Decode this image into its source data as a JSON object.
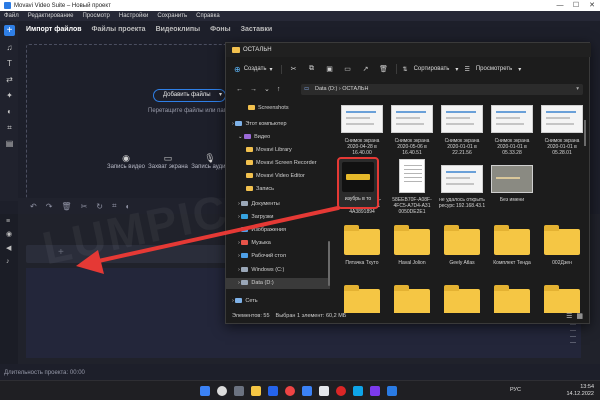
{
  "app": {
    "title": "Movavi Video Suite – Новый проект",
    "window_controls": [
      "—",
      "☐",
      "✕"
    ]
  },
  "menubar": [
    "Файл",
    "Редактирование",
    "Просмотр",
    "Настройки",
    "Сохранить",
    "Справка"
  ],
  "tabs": [
    {
      "label": "Импорт файлов",
      "active": true
    },
    {
      "label": "Файлы проекта"
    },
    {
      "label": "Видеоклипы"
    },
    {
      "label": "Фоны"
    },
    {
      "label": "Заставки"
    }
  ],
  "import": {
    "add_files_label": "Добавить файлы",
    "drop_hint": "Перетащите файлы или папки сюда",
    "buttons": [
      {
        "label": "Запись видео",
        "icon": "webcam-icon"
      },
      {
        "label": "Захват экрана",
        "icon": "monitor-icon"
      },
      {
        "label": "Запись аудио",
        "icon": "microphone-icon"
      }
    ]
  },
  "status": {
    "duration": "Длительность проекта: 00:00"
  },
  "watermark": "LUMPICS.RU",
  "explorer": {
    "title": "ОСТАЛЬН",
    "toolbar": {
      "new_label": "Создать",
      "sort_label": "Сортировать",
      "view_label": "Просмотреть"
    },
    "address": "Data (D:)  ›  ОСТАЛЬН",
    "nav": [
      {
        "label": "Screenshots",
        "color": "#f2c14e"
      },
      {
        "label": "Этот компьютер",
        "color": "#7fb2e8"
      },
      {
        "label": "Видео",
        "color": "#9b6ad8"
      },
      {
        "label": "Movavi Library",
        "color": "#f2c14e"
      },
      {
        "label": "Movavi Screen Recorder",
        "color": "#f2c14e"
      },
      {
        "label": "Movavi Video Editor",
        "color": "#f2c14e"
      },
      {
        "label": "Запись",
        "color": "#f2c14e"
      },
      {
        "label": "Документы",
        "color": "#9aa7b8"
      },
      {
        "label": "Загрузки",
        "color": "#36a3e0"
      },
      {
        "label": "Изображения",
        "color": "#4ea0e8"
      },
      {
        "label": "Музыка",
        "color": "#e8544a"
      },
      {
        "label": "Рабочий стол",
        "color": "#4ea0e8"
      },
      {
        "label": "Windows (C:)",
        "color": "#9aa7b8"
      },
      {
        "label": "Data (D:)",
        "color": "#9aa7b8",
        "selected": true
      },
      {
        "label": "Сеть",
        "color": "#7fb2e8"
      }
    ],
    "files_row1": [
      {
        "label": "Снимок экрана 2020-04-28 в 16.40.00"
      },
      {
        "label": "Снимок экрана 2020-05-06 в 16.40.51"
      },
      {
        "label": "Снимок экрана 2020-01-01 в 22.21.56"
      },
      {
        "label": "Снимок экрана 2020-01-01 в 05.33.28"
      },
      {
        "label": "Снимок экрана 2020-01-01 в 05.28.01"
      }
    ],
    "files_row2": [
      {
        "label": "6741C587-5C65-4AAA-9388-8D1 4A3891894"
      },
      {
        "label": "58EEB70F-A08F-4FC5-A7D4-A31 0050DE2E1"
      },
      {
        "label": "не удалось открыть ресурс 192.168.43.1"
      },
      {
        "label": "Без имени"
      },
      {
        "label": "изубрь в то",
        "selected": true
      }
    ],
    "folders_row3": [
      {
        "label": "Пятачка Тхуто"
      },
      {
        "label": "Haval Jolion"
      },
      {
        "label": "Geely Atlas"
      },
      {
        "label": "Комплект Тенда"
      },
      {
        "label": "002Дзен"
      }
    ],
    "statusbar": {
      "items": "Элементов: 55",
      "selected": "Выбран 1 элемент: 60,2 МБ"
    }
  },
  "taskbar": {
    "lang": "РУС",
    "time": "13:54",
    "date": "14.12.2022"
  }
}
